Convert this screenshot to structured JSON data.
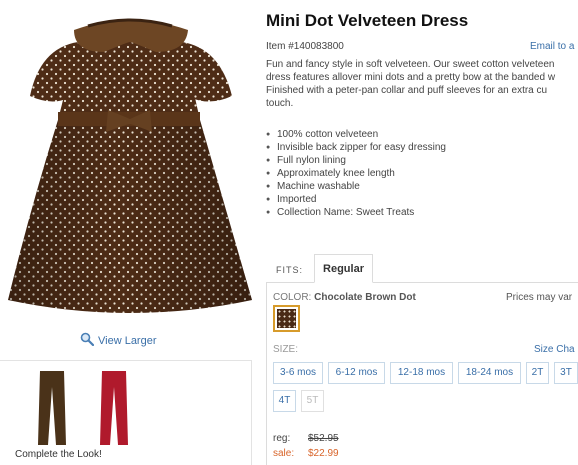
{
  "product": {
    "title": "Mini Dot Velveteen Dress",
    "item_number": "Item #140083800",
    "email_link": "Email to a",
    "description_lines": [
      "Fun and fancy style in soft velveteen. Our sweet cotton velveteen",
      "dress features allover mini dots and a pretty bow at the banded w",
      "Finished with a peter-pan collar and puff sleeves for an extra cu",
      "touch."
    ],
    "features": [
      "100% cotton velveteen",
      "Invisible back zipper for easy dressing",
      "Full nylon lining",
      "Approximately knee length",
      "Machine washable",
      "Imported",
      "Collection Name: Sweet Treats"
    ]
  },
  "gallery": {
    "view_larger": "View Larger",
    "complete_the_look": "Complete the Look!"
  },
  "fits": {
    "label": "FITS:",
    "active_tab": "Regular"
  },
  "color": {
    "label": "COLOR:",
    "value": "Chocolate Brown Dot",
    "swatch_color": "#4a2a16",
    "selected_border": "#d79b2b"
  },
  "prices_note": "Prices may var",
  "size": {
    "label": "SIZE:",
    "chart_link": "Size Cha",
    "options": [
      {
        "label": "3-6 mos",
        "available": true
      },
      {
        "label": "6-12 mos",
        "available": true
      },
      {
        "label": "12-18 mos",
        "available": true
      },
      {
        "label": "18-24 mos",
        "available": true
      },
      {
        "label": "2T",
        "available": true
      },
      {
        "label": "3T",
        "available": true
      },
      {
        "label": "4T",
        "available": true
      },
      {
        "label": "5T",
        "available": false
      }
    ]
  },
  "pricing": {
    "reg_label": "reg:",
    "reg_price": "$52.95",
    "sale_label": "sale:",
    "sale_price": "$22.99",
    "sale_color": "#d8642a"
  }
}
